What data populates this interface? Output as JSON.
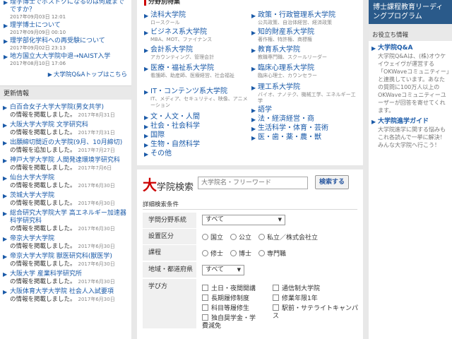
{
  "left": {
    "qa_items": [
      {
        "title": "理学博士でポスドクになるのは何歳までですか？",
        "date": "2017年09月03日 12:01"
      },
      {
        "title": "理学博士について",
        "date": "2017年09月09日 00:10"
      },
      {
        "title": "理学部化学科への再受験について",
        "date": "2017年09月02日 23:13"
      },
      {
        "title": "地方国立大大学院中退→NAIST入学",
        "date": "2017年08月10日 17:06"
      }
    ],
    "qa_top_link": "大学院Q&Aトップはこちら",
    "news_heading": "更新情報",
    "news": [
      {
        "title": "白百合女子大学大学院(男女共学)",
        "suffix": "の情報を掲載しました。",
        "date": "2017年8月31日"
      },
      {
        "title": "大阪大学大学院 文学研究科",
        "suffix": "の情報を掲載しました。",
        "date": "2017年7月31日"
      },
      {
        "title": "出願締切間近の大学院(9月、10月締切)",
        "suffix": "の情報を追加しました。",
        "date": "2017年7月27日"
      },
      {
        "title": "神戸大学大学院 人間発達環境学研究科",
        "suffix": "の情報を掲載しました。",
        "date": "2017年7月6日"
      },
      {
        "title": "仙台大学大学院",
        "suffix": "の情報を掲載しました。",
        "date": "2017年6月30日"
      },
      {
        "title": "茨城大学大学院",
        "suffix": "の情報を掲載しました。",
        "date": "2017年6月30日"
      },
      {
        "title": "総合研究大学院大学 高エネルギー加速器科学研究科",
        "suffix": "の情報を掲載しました。",
        "date": "2017年6月30日"
      },
      {
        "title": "帝京大学大学院",
        "suffix": "の情報を掲載しました。",
        "date": "2017年6月30日"
      },
      {
        "title": "帝京大学大学院 獣医研究科(獣医学)",
        "suffix": "の情報を掲載しました。",
        "date": "2017年6月30日"
      },
      {
        "title": "大阪大学 産業科学研究所",
        "suffix": "の情報を掲載しました。",
        "date": "2017年6月30日"
      },
      {
        "title": "大阪体育大学大学院 社会人入試要項",
        "suffix": "の情報を掲載しました。",
        "date": "2017年6月30日"
      }
    ]
  },
  "special": {
    "heading": "分野別特集",
    "col1": [
      {
        "label": "法科大学院",
        "sub": "ロースクール"
      },
      {
        "label": "ビジネス系大学院",
        "sub": "MBA、MOT、ファイナンス"
      },
      {
        "label": "会計系大学院",
        "sub": "アカウンティング、管理会計"
      },
      {
        "label": "医療・福祉系大学院",
        "sub": "看護師、助産師、医療経営、社会福祉"
      },
      {
        "label": "IT・コンテンツ系大学院",
        "sub": "IT、メディア、セキュリティ、映像、アニメーション"
      },
      {
        "label": "文・人文・人間",
        "sub": ""
      },
      {
        "label": "社会・社会科学",
        "sub": ""
      },
      {
        "label": "国際",
        "sub": ""
      },
      {
        "label": "生物・自然科学",
        "sub": ""
      },
      {
        "label": "その他",
        "sub": ""
      }
    ],
    "col2": [
      {
        "label": "政策・行政管理系大学院",
        "sub": "公共政策、自治体経営、経済政策"
      },
      {
        "label": "知的財産系大学院",
        "sub": "著作権、特許権、商標権"
      },
      {
        "label": "教育系大学院",
        "sub": "教職専門職、スクールリーダー"
      },
      {
        "label": "臨床心理系大学院",
        "sub": "臨床心理士、カウンセラー"
      },
      {
        "label": "理工系大学院",
        "sub": "バイオ、ナノテク、機械工学、エネルギー工学"
      },
      {
        "label": "語学",
        "sub": ""
      },
      {
        "label": "法・経済経営・商",
        "sub": ""
      },
      {
        "label": "生活科学・体育・芸術",
        "sub": ""
      },
      {
        "label": "医・歯・薬・農・獣",
        "sub": ""
      }
    ]
  },
  "search": {
    "title_big": "大",
    "title_rest": "学院検索",
    "placeholder": "大学院名・フリーワード",
    "button": "検索する",
    "conditions_label": "詳細検索条件",
    "field_label": "学問分野系統",
    "field_value": "すべて",
    "type_label": "設置区分",
    "type_options": [
      "国立",
      "公立",
      "私立／株式会社立"
    ],
    "course_label": "課程",
    "course_options": [
      "修士",
      "博士",
      "専門職"
    ],
    "region_label": "地域・都道府県",
    "region_value": "すべて",
    "study_label": "学び方",
    "study_options": [
      "土日・夜間開講",
      "長期履修制度",
      "科目等履修生",
      "独自奨学金・学費減免",
      "通信制大学院",
      "修業年限1年",
      "駅前・サテライトキャンパス"
    ]
  },
  "right": {
    "banner": "博士課程教育リーディングプログラム",
    "util_heading": "お役立ち情報",
    "items": [
      {
        "title": "大学院Q&A",
        "body": "大学院Q&Aは、(株)オウケイウェイヴが運営する「OKWaveコミュニティー」と連携しています。あなたの質問に100万人以上のOKWaveコミュニティーユーザーが回答を寄せてくれます。"
      },
      {
        "title": "大学院進学ガイド",
        "body": "大学院進学に関する悩みもこれ各読んで一挙に解決！みんな大学院へ行こう！"
      }
    ]
  }
}
